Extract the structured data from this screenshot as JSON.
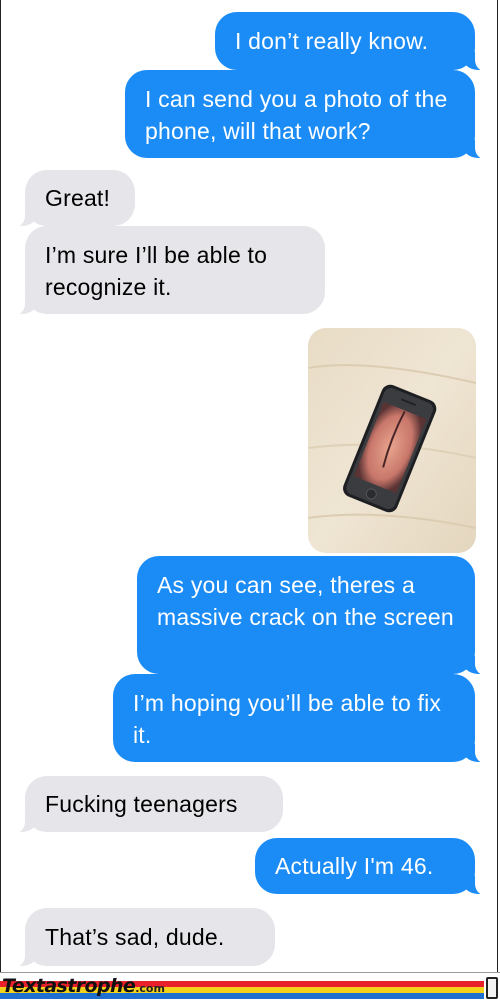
{
  "messages": [
    {
      "side": "sent",
      "text": "I don’t really know."
    },
    {
      "side": "sent",
      "text": "I can send you a photo of the phone, will that work?"
    },
    {
      "side": "received",
      "text": "Great!"
    },
    {
      "side": "received",
      "text": "I’m sure I’ll be able to recognize it."
    },
    {
      "side": "sent",
      "type": "photo"
    },
    {
      "side": "sent",
      "text": "As you can see, theres a massive crack on the screen"
    },
    {
      "side": "sent",
      "text": "I’m hoping you’ll be able to fix it."
    },
    {
      "side": "received",
      "text": "Fucking teenagers"
    },
    {
      "side": "sent",
      "text": "Actually I'm 46."
    },
    {
      "side": "received",
      "text": "That’s sad, dude."
    }
  ],
  "footer": {
    "brand": "Textastrophe",
    "domain": ".com"
  },
  "colors": {
    "sent_bubble": "#1b8cf6",
    "received_bubble": "#e5e5ea",
    "footer_stripes": [
      "#e8212a",
      "#f3d21c",
      "#1e6fd0"
    ]
  }
}
